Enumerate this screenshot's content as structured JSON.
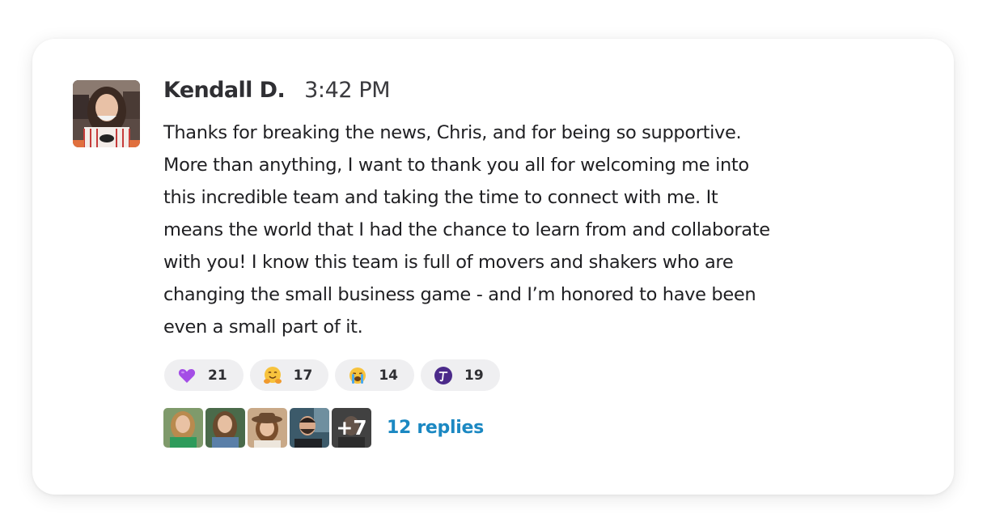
{
  "message": {
    "author": "Kendall D.",
    "time": "3:42 PM",
    "lines": [
      "Thanks for breaking the news, Chris, and for being so supportive.",
      "More than anything, I want to thank you all for welcoming me into",
      "this incredible team and taking the time to connect with me. It",
      "means the world that I had the chance to learn from and collaborate",
      "with you! I know this team is full of movers and shakers who are",
      "changing the small business game - and I’m honored to have been",
      "even a small part of it."
    ]
  },
  "reactions": [
    {
      "icon": "purple-heart-icon",
      "count": "21"
    },
    {
      "icon": "hugging-face-icon",
      "count": "17"
    },
    {
      "icon": "crying-face-icon",
      "count": "14"
    },
    {
      "icon": "brand-logo-icon",
      "count": "19"
    }
  ],
  "replies": {
    "more_count": "+7",
    "label": "12 replies"
  },
  "colors": {
    "link": "#1b88c2",
    "reaction_bg": "#efeff1",
    "text": "#1f1f22"
  }
}
